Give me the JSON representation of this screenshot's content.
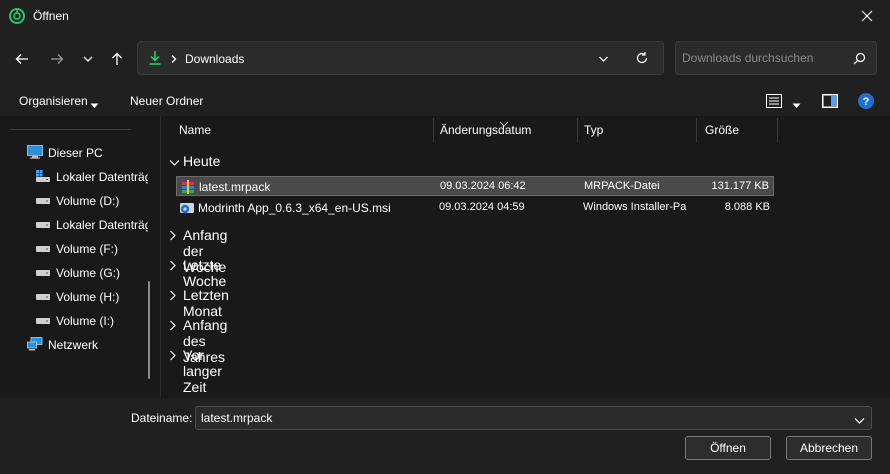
{
  "window": {
    "title": "Öffnen",
    "app_icon": "modrinth-icon",
    "accent": "#1bd96a"
  },
  "navigation": {
    "back": "arrow-left-icon",
    "forward": "arrow-right-icon",
    "recent": "chevron-down-icon",
    "up": "arrow-up-icon"
  },
  "address": {
    "location": "Downloads",
    "icon": "download-icon"
  },
  "search": {
    "placeholder": "Downloads durchsuchen"
  },
  "commands": {
    "organize": "Organisieren",
    "new_folder": "Neuer Ordner"
  },
  "sidebar": {
    "items": [
      {
        "label": "Dieser PC",
        "icon": "pc-icon"
      },
      {
        "label": "Lokaler Datenträger (C:)",
        "icon": "drive-os-icon"
      },
      {
        "label": "Volume (D:)",
        "icon": "drive-icon"
      },
      {
        "label": "Lokaler Datenträger (E:)",
        "icon": "drive-icon"
      },
      {
        "label": "Volume (F:)",
        "icon": "drive-icon"
      },
      {
        "label": "Volume (G:)",
        "icon": "drive-icon"
      },
      {
        "label": "Volume (H:)",
        "icon": "drive-icon"
      },
      {
        "label": "Volume (I:)",
        "icon": "drive-icon"
      },
      {
        "label": "Netzwerk",
        "icon": "network-icon"
      }
    ]
  },
  "columns": {
    "name": "Name",
    "date": "Änderungsdatum",
    "type": "Typ",
    "size": "Größe"
  },
  "groups": [
    {
      "label": "Heute",
      "expanded": true
    },
    {
      "label": "Anfang der Woche",
      "expanded": false
    },
    {
      "label": "Letzte Woche",
      "expanded": false
    },
    {
      "label": "Letzten Monat",
      "expanded": false
    },
    {
      "label": "Anfang des Jahres",
      "expanded": false
    },
    {
      "label": "Vor langer Zeit",
      "expanded": false
    }
  ],
  "files": [
    {
      "name": "latest.mrpack",
      "date": "09.03.2024 06:42",
      "type": "MRPACK-Datei",
      "size": "131.177 KB",
      "icon": "archive-icon",
      "selected": true
    },
    {
      "name": "Modrinth App_0.6.3_x64_en-US.msi",
      "date": "09.03.2024 04:59",
      "type": "Windows Installer-Paket",
      "size": "8.088 KB",
      "icon": "installer-icon",
      "selected": false
    }
  ],
  "footer": {
    "filename_label": "Dateiname:",
    "filename_value": "latest.mrpack",
    "open": "Öffnen",
    "cancel": "Abbrechen"
  }
}
